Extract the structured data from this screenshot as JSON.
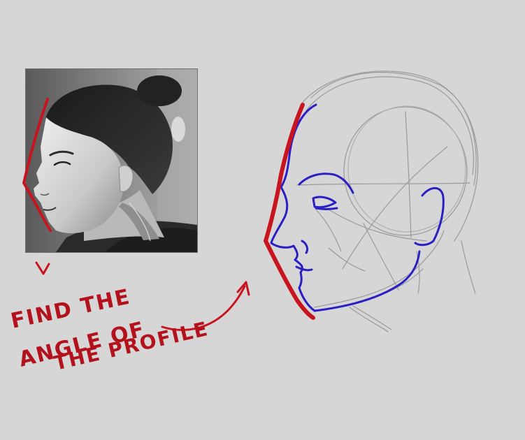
{
  "annotation": {
    "lines": [
      "FIND THE",
      "ANGLE OF",
      "THE PROFILE"
    ],
    "color": "#b3121d"
  },
  "colors": {
    "background": "#d6d6d6",
    "profile_angle_line": "#c8141e",
    "profile_contour": "#2a1fc4",
    "construction_sketch": "#9a9a9a",
    "photo_frame": "#6e6e6e"
  },
  "icons": {
    "photo_arrow": "down-arrow-icon",
    "pointer_arrow": "curved-arrow-icon"
  }
}
